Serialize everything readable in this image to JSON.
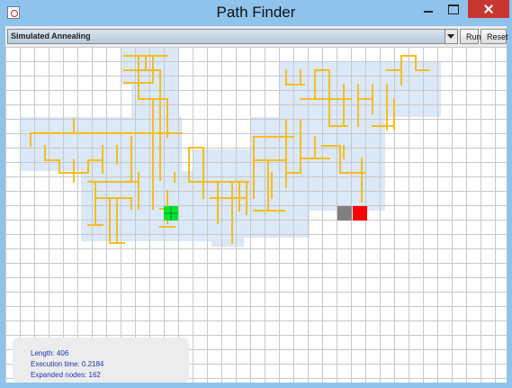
{
  "window": {
    "title": "Path Finder"
  },
  "toolbar": {
    "algorithm": "Simulated Annealing",
    "run_label": "Run",
    "reset_label": "Reset"
  },
  "stats": {
    "length": "Length: 406",
    "execution_time": "Execution time: 0.2184",
    "expanded_nodes": "Expanded nodes: 162"
  },
  "colors": {
    "path": "#f5bd1f",
    "explored": "#dbe8f7",
    "start": "#00e62e",
    "goal": "#ff0000",
    "current": "#808080",
    "grid": "#c8c8c8"
  }
}
